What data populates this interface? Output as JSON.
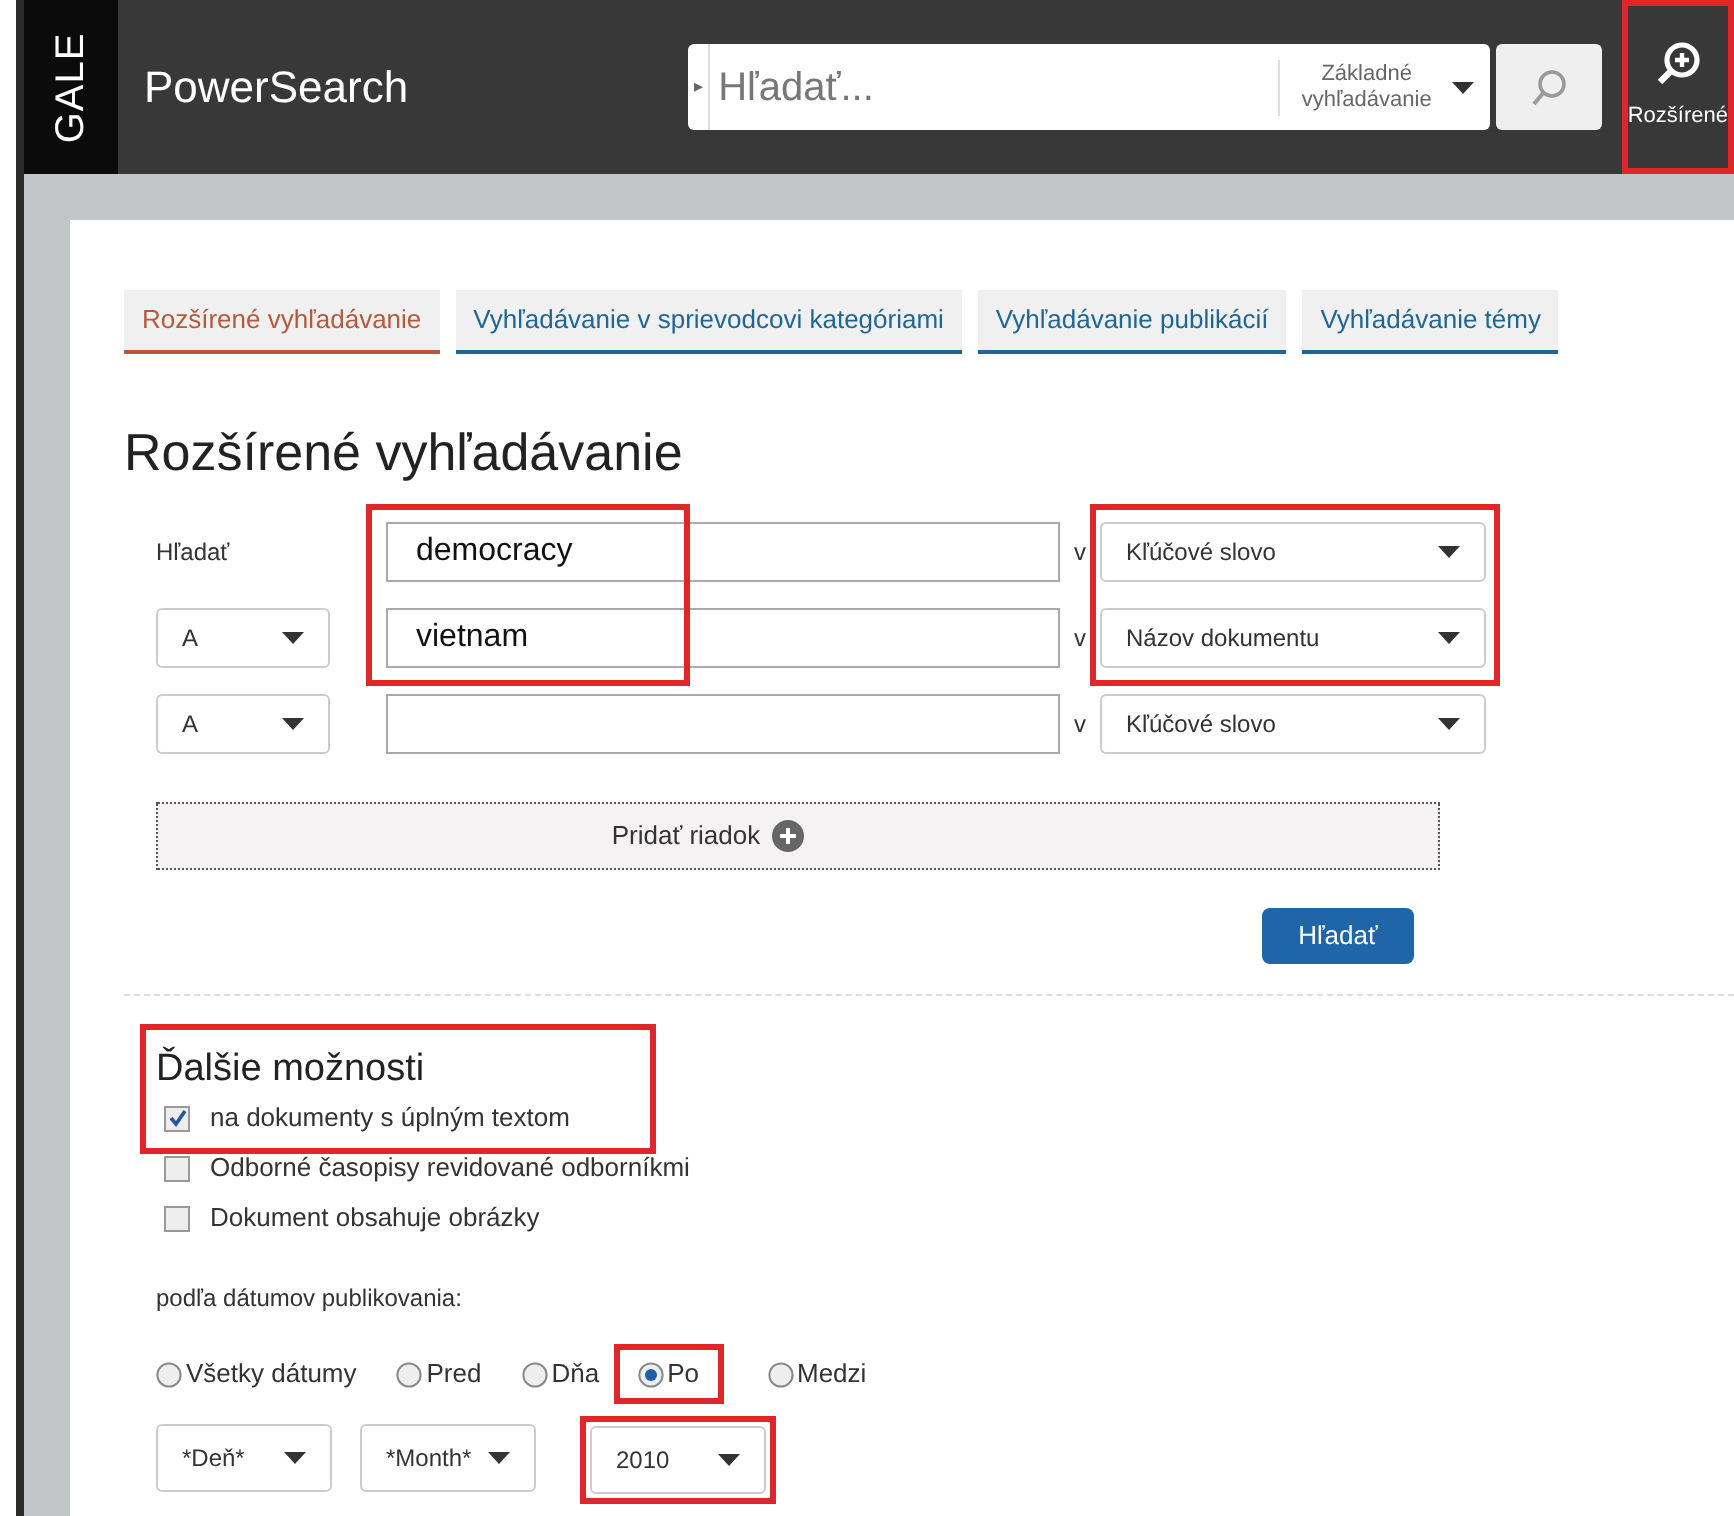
{
  "header": {
    "brand": "GALE",
    "product": "PowerSearch",
    "search": {
      "marker": "▸",
      "placeholder": "Hľadať...",
      "mode": "Základné vyhľadávanie"
    },
    "advanced_button": {
      "label": "Rozšírené",
      "highlighted": true
    }
  },
  "tabs": [
    {
      "label": "Rozšírené vyhľadávanie",
      "selected": true
    },
    {
      "label": "Vyhľadávanie v sprievodcovi kategóriami",
      "selected": false
    },
    {
      "label": "Vyhľadávanie publikácií",
      "selected": false
    },
    {
      "label": "Vyhľadávanie témy",
      "selected": false
    }
  ],
  "heading": "Rozšírené vyhľadávanie",
  "query_rows": [
    {
      "kind": "label",
      "label": "Hľadať",
      "term": "democracy",
      "in": "v",
      "field": "Kľúčové slovo",
      "highlighted": true
    },
    {
      "kind": "operator",
      "operator": "A",
      "term": "vietnam",
      "in": "v",
      "field": "Názov dokumentu",
      "highlighted": true
    },
    {
      "kind": "operator",
      "operator": "A",
      "term": "",
      "in": "v",
      "field": "Kľúčové slovo",
      "highlighted": false
    }
  ],
  "add_row": "Pridať riadok",
  "search_button": "Hľadať",
  "more_options": {
    "title": "Ďalšie možnosti",
    "highlighted": true,
    "checkboxes": [
      {
        "label": "na dokumenty s úplným textom",
        "checked": true
      },
      {
        "label": "Odborné časopisy revidované odborníkmi",
        "checked": false
      },
      {
        "label": "Dokument obsahuje obrázky",
        "checked": false
      }
    ],
    "date_label": "podľa dátumov publikovania:",
    "date_options": [
      {
        "label": "Všetky dátumy",
        "selected": false,
        "highlighted": false
      },
      {
        "label": "Pred",
        "selected": false,
        "highlighted": false
      },
      {
        "label": "Dňa",
        "selected": false,
        "highlighted": false
      },
      {
        "label": "Po",
        "selected": true,
        "highlighted": true
      },
      {
        "label": "Medzi",
        "selected": false,
        "highlighted": false
      }
    ],
    "date_selects": [
      {
        "value": "*Deň*",
        "highlighted": false
      },
      {
        "value": "*Month*",
        "highlighted": false
      },
      {
        "value": "2010",
        "highlighted": true
      }
    ]
  }
}
